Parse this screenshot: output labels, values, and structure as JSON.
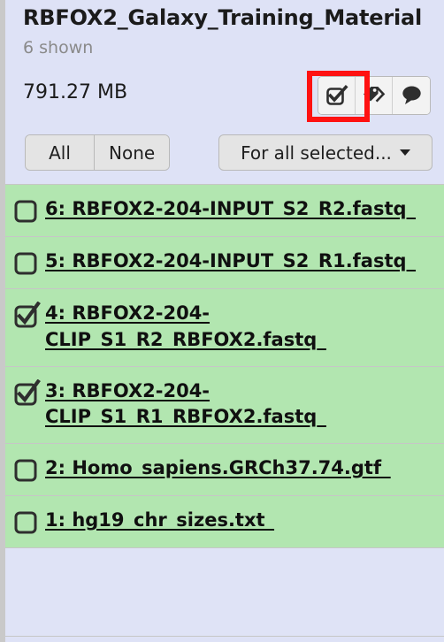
{
  "history": {
    "title": "RBFOX2_Galaxy_Training_Material",
    "shown_count_label": "6 shown",
    "total_size": "791.27 MB"
  },
  "header_icons": [
    {
      "name": "selection-mode-icon",
      "glyph": "checkbox-checked",
      "highlighted": true
    },
    {
      "name": "tags-icon",
      "glyph": "tags",
      "highlighted": false
    },
    {
      "name": "annotation-icon",
      "glyph": "speech-bubble",
      "highlighted": false
    }
  ],
  "selection_controls": {
    "all_label": "All",
    "none_label": "None",
    "for_all_selected_label": "For all selected...",
    "caret": "caret-down-icon"
  },
  "colors": {
    "header_background": "#dee2f6",
    "dataset_ok_background": "#b2e6b0",
    "highlight_outline": "#ff1111",
    "muted_text": "#8a8a8a",
    "button_background": "#e4e4e4"
  },
  "datasets": [
    {
      "hid": "6",
      "name": "6: RBFOX2-204-INPUT_S2_R2.fastq_",
      "selected": false,
      "state": "ok"
    },
    {
      "hid": "5",
      "name": "5: RBFOX2-204-INPUT_S2_R1.fastq_",
      "selected": false,
      "state": "ok"
    },
    {
      "hid": "4",
      "name": "4: RBFOX2-204-CLIP_S1_R2_RBFOX2.fastq_",
      "selected": true,
      "state": "ok"
    },
    {
      "hid": "3",
      "name": "3: RBFOX2-204-CLIP_S1_R1_RBFOX2.fastq_",
      "selected": true,
      "state": "ok"
    },
    {
      "hid": "2",
      "name": "2: Homo_sapiens.GRCh37.74.gtf_",
      "selected": false,
      "state": "ok"
    },
    {
      "hid": "1",
      "name": "1: hg19_chr_sizes.txt_",
      "selected": false,
      "state": "ok"
    }
  ]
}
